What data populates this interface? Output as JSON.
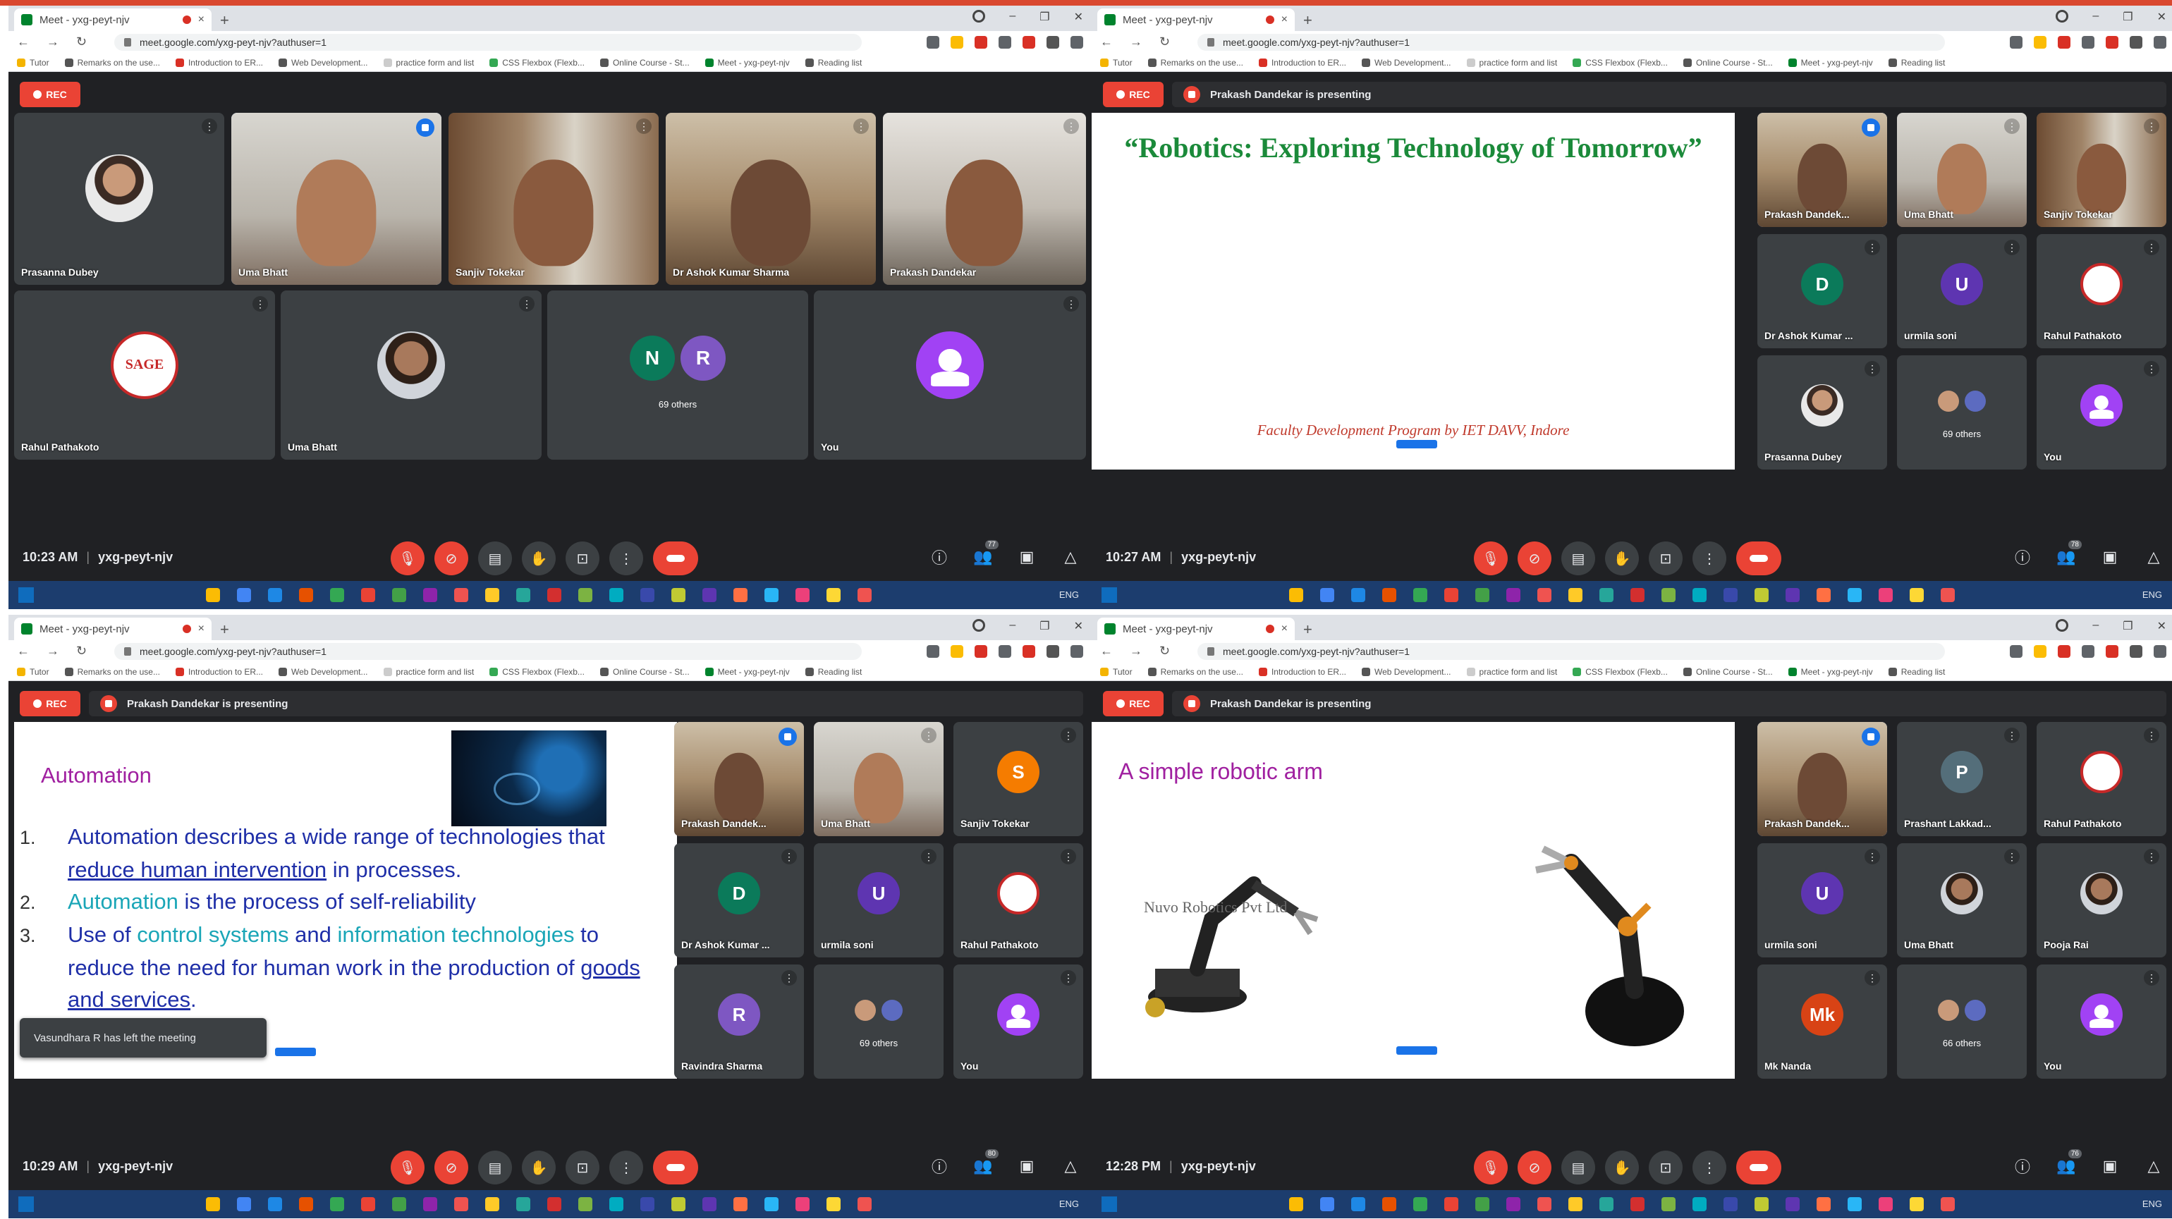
{
  "browser": {
    "tab_title": "Meet - yxg-peyt-njv",
    "tab_close": "×",
    "new_tab": "+",
    "url": "meet.google.com/yxg-peyt-njv?authuser=1",
    "bookmarks": [
      "Tutor",
      "Remarks on the use...",
      "Introduction to ER...",
      "Web Development...",
      "practice form and list",
      "CSS Flexbox (Flexb...",
      "Online Course - St...",
      "Meet - yxg-peyt-njv",
      "Reading list"
    ],
    "bookmark_colors": [
      "#f4b400",
      "#555555",
      "#d93025",
      "#555555",
      "#cccccc",
      "#34a853",
      "#555555",
      "#00832d",
      "#555555"
    ],
    "ext_colors": [
      "#5f6368",
      "#fbbc04",
      "#d93025",
      "#5f6368",
      "#d93025",
      "#555555",
      "#5f6368"
    ]
  },
  "meet": {
    "rec_label": "REC",
    "presenting_text": "Prakash Dandekar is presenting",
    "meeting_code": "yxg-peyt-njv",
    "mute_glyph": "⋮",
    "colors": {
      "accent": "#8ab4f8",
      "red": "#ea4335",
      "purple": "#a142f4",
      "tile": "#3c4043",
      "bg": "#202124"
    }
  },
  "screens": [
    {
      "time": "10:23 AM",
      "tiles": [
        {
          "name": "Prasanna Dubey"
        },
        {
          "name": "Uma Bhatt"
        },
        {
          "name": "Sanjiv Tokekar"
        },
        {
          "name": "Dr Ashok Kumar Sharma"
        },
        {
          "name": "Prakash Dandekar"
        },
        {
          "name": "Rahul Pathakoto",
          "logo": "SAGE"
        },
        {
          "name": "Uma Bhatt"
        },
        {
          "name": "69 others",
          "initials": [
            "N",
            "R"
          ]
        },
        {
          "name": "You"
        }
      ]
    },
    {
      "time": "10:27 AM",
      "slide": {
        "title": "“Robotics: Exploring Technology of Tomorrow”",
        "footer": "Faculty Development Program by IET DAVV, Indore"
      },
      "tiles": [
        {
          "name": "Prakash Dandek..."
        },
        {
          "name": "Uma Bhatt"
        },
        {
          "name": "Sanjiv Tokekar"
        },
        {
          "name": "Dr Ashok Kumar ...",
          "initial": "D"
        },
        {
          "name": "urmila soni",
          "initial": "U"
        },
        {
          "name": "Rahul Pathakoto"
        },
        {
          "name": "Prasanna Dubey"
        },
        {
          "name": "69 others"
        },
        {
          "name": "You"
        }
      ]
    },
    {
      "time": "10:29 AM",
      "slide": {
        "heading": "Automation",
        "items": [
          {
            "num": "1.",
            "pre": "Automation describes a wide range of technologies that ",
            "link": "reduce human intervention",
            "post": " in processes."
          },
          {
            "num": "2.",
            "hl": "Automation",
            "post": " is the process of self-reliability"
          },
          {
            "num": "3.",
            "pre": "Use of ",
            "hl1": "control systems",
            "mid": " and ",
            "hl2": "information technologies",
            "post": " to reduce the need for human work in the production of ",
            "link": "goods and services",
            "end": "."
          }
        ],
        "toast": "Vasundhara R has left the meeting"
      },
      "tiles": [
        {
          "name": "Prakash Dandek..."
        },
        {
          "name": "Uma Bhatt"
        },
        {
          "name": "Sanjiv Tokekar",
          "initial": "S"
        },
        {
          "name": "Dr Ashok Kumar ...",
          "initial": "D"
        },
        {
          "name": "urmila soni",
          "initial": "U"
        },
        {
          "name": "Rahul Pathakoto"
        },
        {
          "name": "Ravindra Sharma",
          "initial": "R"
        },
        {
          "name": "69 others"
        },
        {
          "name": "You"
        }
      ]
    },
    {
      "time": "12:28 PM",
      "slide": {
        "heading": "A simple robotic arm",
        "label": "Nuvo Robotics Pvt Ltd"
      },
      "tiles": [
        {
          "name": "Prakash Dandek..."
        },
        {
          "name": "Prashant Lakkad...",
          "initial": "P"
        },
        {
          "name": "Rahul Pathakoto"
        },
        {
          "name": "urmila soni",
          "initial": "U"
        },
        {
          "name": "Uma Bhatt"
        },
        {
          "name": "Pooja Rai"
        },
        {
          "name": "Mk Nanda",
          "initial": "Mk"
        },
        {
          "name": "66 others"
        },
        {
          "name": "You"
        }
      ]
    }
  ],
  "controls": {
    "mic_glyph": "🎙",
    "cam_glyph": "⊘",
    "cc_glyph": "▤",
    "hand_glyph": "✋",
    "present_glyph": "⊡",
    "more_glyph": "⋮",
    "info_glyph": "ⓘ",
    "people_glyph": "👥",
    "chat_glyph": "▣",
    "activities_glyph": "△",
    "people_counts": [
      "77",
      "78",
      "80",
      "76"
    ]
  },
  "taskbar": {
    "tray": "ENG"
  }
}
